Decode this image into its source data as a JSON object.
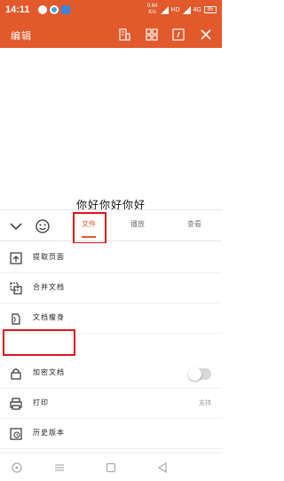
{
  "status_bar": {
    "time": "14:11",
    "speed_value": "0.64",
    "speed_unit": "K/s",
    "network": "HD",
    "signal_label": "4G",
    "battery": "85"
  },
  "toolbar": {
    "title": "编辑",
    "icons": [
      "building-icon",
      "grid-icon",
      "window-icon",
      "close-icon"
    ]
  },
  "document": {
    "text": "你好你好你好"
  },
  "tabs": [
    {
      "label": "文件",
      "active": true
    },
    {
      "label": "播放",
      "active": false
    },
    {
      "label": "查看",
      "active": false
    }
  ],
  "menu": [
    {
      "label": "提取页面",
      "icon": "extract-page-icon"
    },
    {
      "label": "合并文档",
      "icon": "merge-document-icon"
    },
    {
      "label": "文档瘦身",
      "icon": "slim-document-icon",
      "highlighted": true
    },
    {
      "label": "加密文档",
      "icon": "lock-icon",
      "toggle": false
    },
    {
      "label": "打印",
      "icon": "printer-icon",
      "extra": "支持"
    },
    {
      "label": "历史版本",
      "icon": "history-icon"
    }
  ],
  "colors": {
    "accent": "#e2592b",
    "highlight": "#e0131b"
  }
}
